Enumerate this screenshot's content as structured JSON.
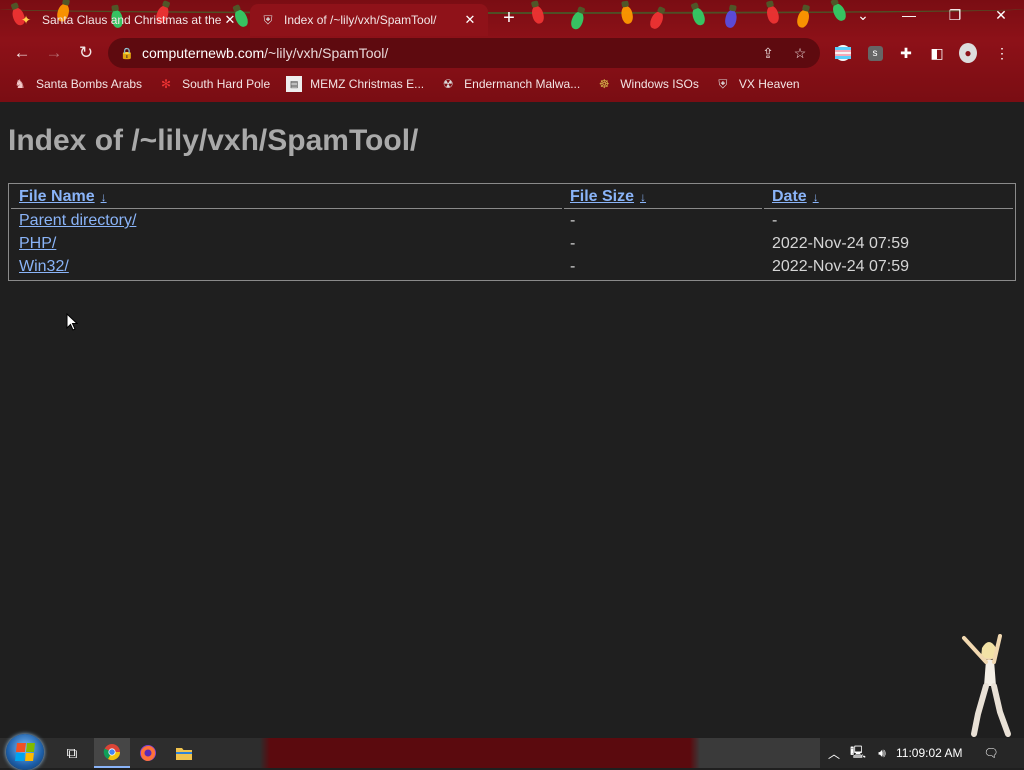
{
  "browser": {
    "tabs": [
      {
        "title": "Santa Claus and Christmas at the",
        "active": false,
        "favicon": "bulb-favicon-icon"
      },
      {
        "title": "Index of /~lily/vxh/SpamTool/",
        "active": true,
        "favicon": "vxh-favicon-icon"
      }
    ],
    "url": {
      "host": "computernewb.com",
      "path": "/~lily/vxh/SpamTool/"
    },
    "bookmarks": [
      {
        "label": "Santa Bombs Arabs",
        "icon": "santa-icon"
      },
      {
        "label": "South Hard Pole",
        "icon": "snowflake-icon"
      },
      {
        "label": "MEMZ Christmas E...",
        "icon": "memz-icon"
      },
      {
        "label": "Endermanch Malwa...",
        "icon": "endermanch-icon"
      },
      {
        "label": "Windows ISOs",
        "icon": "buddha-icon"
      },
      {
        "label": "VX Heaven",
        "icon": "vx-heaven-icon"
      }
    ],
    "theme": {
      "frame": "#8d1118",
      "omnibox": "#5e0a0f",
      "link": "#8ab4f8"
    }
  },
  "page": {
    "heading": "Index of /~lily/vxh/SpamTool/",
    "columns": [
      {
        "label": "File Name",
        "sort_arrow": "↓"
      },
      {
        "label": "File Size",
        "sort_arrow": "↓"
      },
      {
        "label": "Date",
        "sort_arrow": "↓"
      }
    ],
    "rows": [
      {
        "name": "Parent directory/",
        "size": "-",
        "date": "-"
      },
      {
        "name": "PHP/",
        "size": "-",
        "date": "2022-Nov-24 07:59"
      },
      {
        "name": "Win32/",
        "size": "-",
        "date": "2022-Nov-24 07:59"
      }
    ]
  },
  "taskbar": {
    "clock": "11:09:02 AM",
    "pinned": [
      "task-view-icon",
      "chrome-icon",
      "firefox-icon",
      "file-explorer-icon"
    ]
  }
}
